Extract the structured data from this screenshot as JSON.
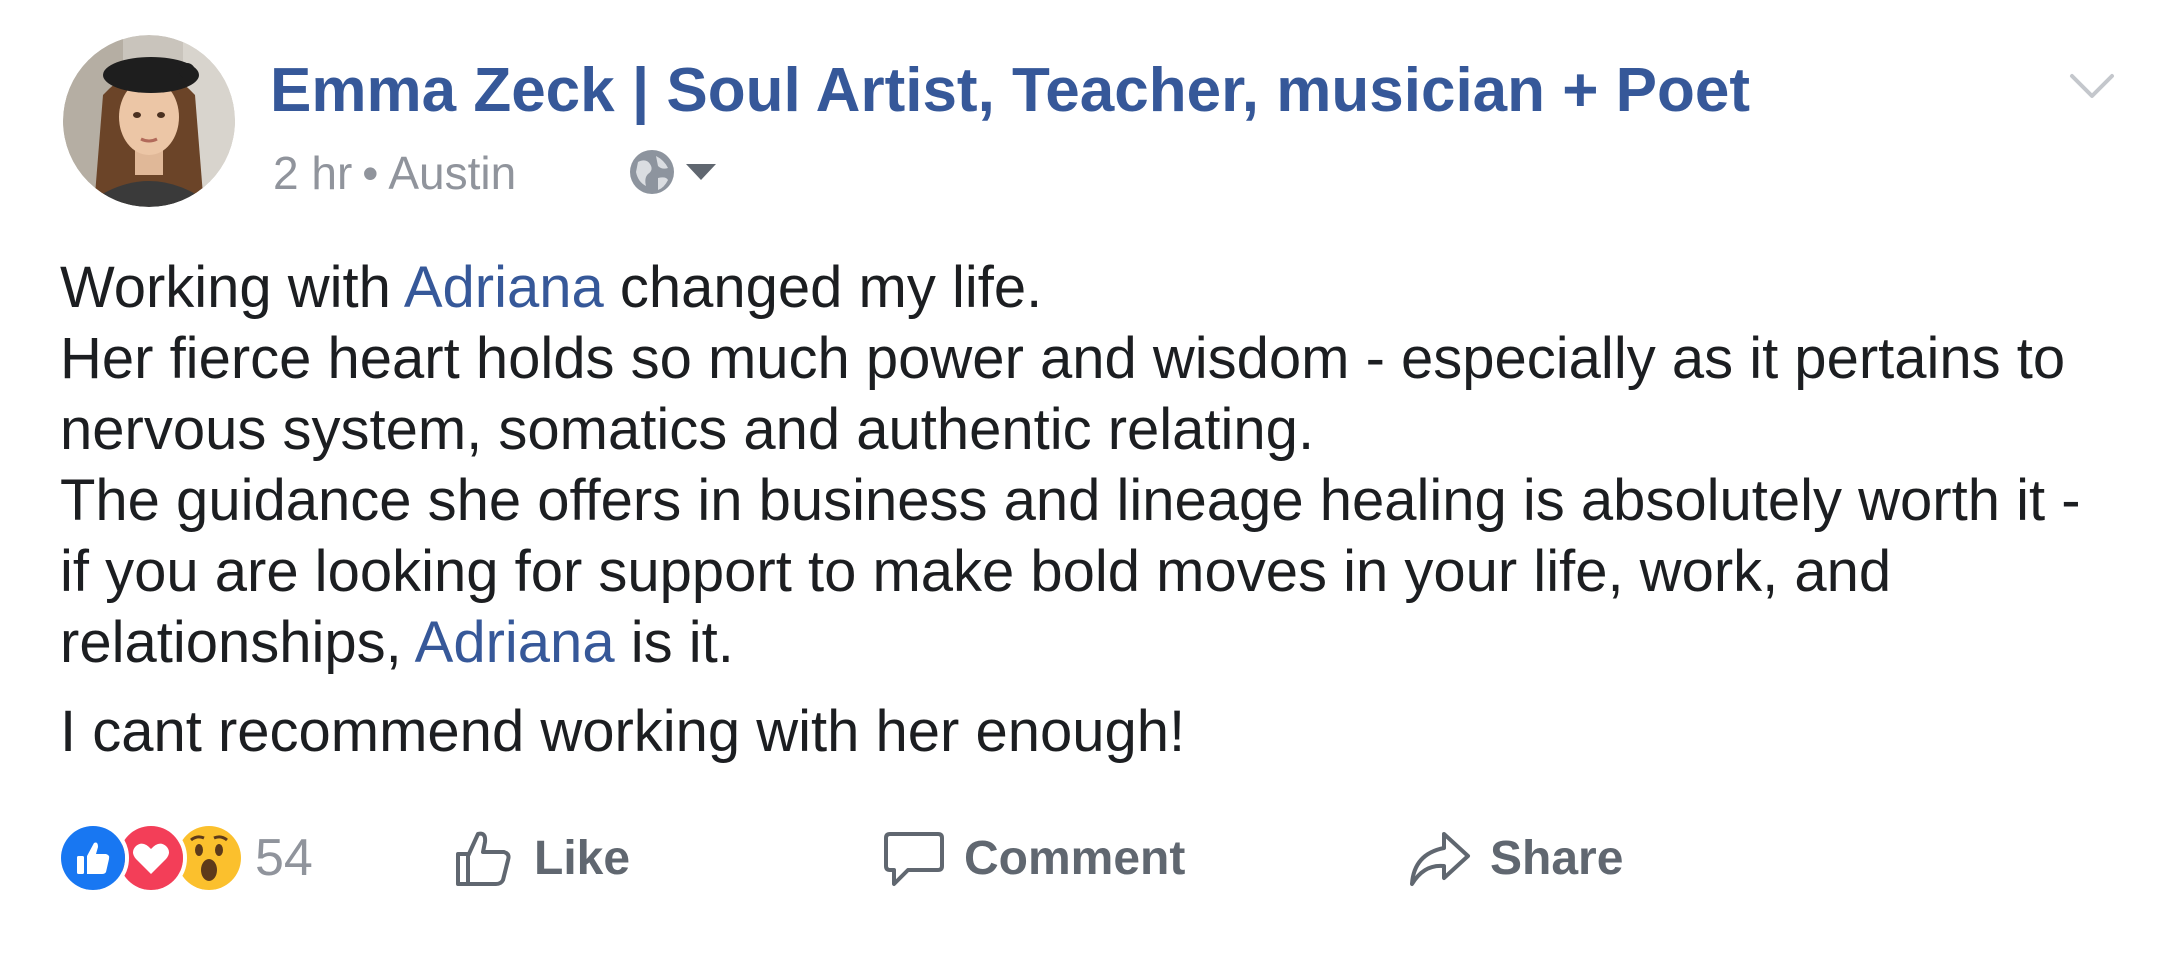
{
  "post": {
    "author": "Emma Zeck | Soul Artist, Teacher, musician + Poet",
    "time": "2 hr",
    "separator": "•",
    "location": "Austin",
    "privacy_icon": "globe-icon",
    "body": {
      "line1_before": "Working with ",
      "mention1": "Adriana",
      "line1_after": " changed my life.",
      "text2": "Her fierce heart holds so much power and wisdom - especially as it pertains to nervous system, somatics and authentic relating.",
      "text3": "The guidance she offers in business and lineage healing is absolutely worth it - if you are looking for support to make bold moves in your life, work, and relationships, ",
      "mention2": "Adriana",
      "text3_after": " is it.",
      "closing": "I cant recommend working with her enough!"
    },
    "reactions": {
      "types": [
        "like-icon",
        "love-icon",
        "wow-icon"
      ],
      "count": "54"
    },
    "actions": {
      "like": "Like",
      "comment": "Comment",
      "share": "Share"
    },
    "colors": {
      "link": "#365899",
      "meta": "#90949c",
      "action": "#606770",
      "like": "#1877f2",
      "love": "#f33e58",
      "wow": "#fbc02d"
    }
  }
}
